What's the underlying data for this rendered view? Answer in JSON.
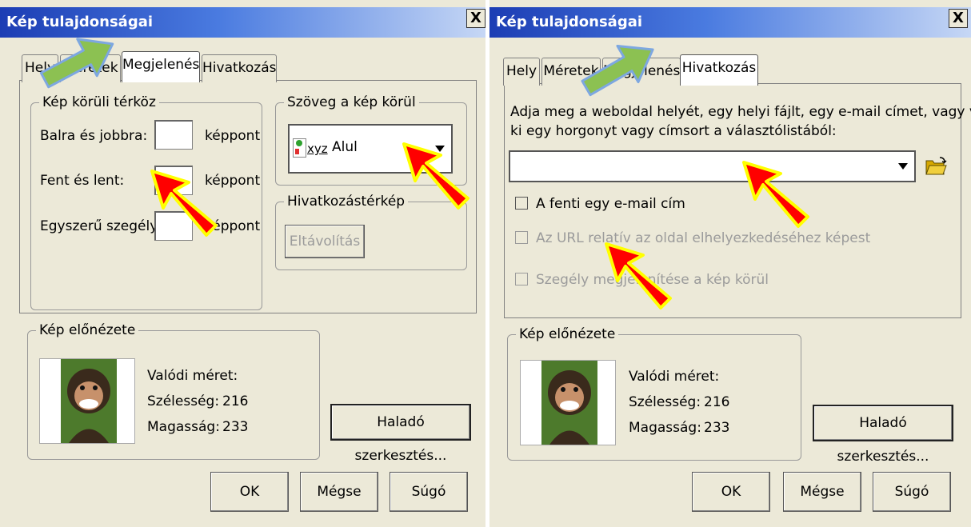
{
  "left_dialog": {
    "title": "Kép tulajdonságai",
    "close": "X",
    "tabs": [
      "Hely",
      "Méretek",
      "Megjelenés",
      "Hivatkozás"
    ],
    "active_tab": "Megjelenés",
    "spacing_group": {
      "legend": "Kép körüli térköz",
      "rows": [
        {
          "label": "Balra és jobbra:",
          "value": "",
          "unit": "képpont"
        },
        {
          "label": "Fent és lent:",
          "value": "",
          "unit": "képpont"
        },
        {
          "label": "Egyszerű szegély:",
          "value": "",
          "unit": "képpont"
        }
      ]
    },
    "wrap_group": {
      "legend": "Szöveg a kép körül",
      "icon_text": "xyz",
      "selected": "Alul"
    },
    "imagemap_group": {
      "legend": "Hivatkozástérkép",
      "remove_button": "Eltávolítás"
    },
    "preview_group": {
      "legend": "Kép előnézete",
      "real_size": "Valódi méret:",
      "width_label": "Szélesség:",
      "width_value": "216",
      "height_label": "Magasság:",
      "height_value": "233",
      "advanced_button": "Haladó szerkesztés..."
    },
    "buttons": {
      "ok": "OK",
      "cancel": "Mégse",
      "help": "Súgó"
    }
  },
  "right_dialog": {
    "title": "Kép tulajdonságai",
    "close": "X",
    "tabs": [
      "Hely",
      "Méretek",
      "Megjelenés",
      "Hivatkozás"
    ],
    "active_tab": "Hivatkozás",
    "instruction_line1": "Adja meg a weboldal helyét, egy helyi fájlt, egy e-mail címet, vagy válasszon",
    "instruction_line2": "ki egy horgonyt vagy címsort a választólistából:",
    "url_value": "",
    "checkboxes": [
      {
        "label": "A fenti egy e-mail cím",
        "checked": false,
        "enabled": true
      },
      {
        "label": "Az URL relatív az oldal elhelyezkedéséhez képest",
        "checked": false,
        "enabled": false
      },
      {
        "label": "Szegély megjelenítése a kép körül",
        "checked": false,
        "enabled": false
      }
    ],
    "preview_group": {
      "legend": "Kép előnézete",
      "real_size": "Valódi méret:",
      "width_label": "Szélesség:",
      "width_value": "216",
      "height_label": "Magasság:",
      "height_value": "233",
      "advanced_button": "Haladó szerkesztés..."
    },
    "buttons": {
      "ok": "OK",
      "cancel": "Mégse",
      "help": "Súgó"
    }
  },
  "colors": {
    "dialog_bg": "#ece9d8",
    "title_bar": "#1c3db4",
    "annotation_arrow": "#ff0000",
    "annotation_outline": "#ffff00",
    "tab_arrow": "#8cc152"
  }
}
